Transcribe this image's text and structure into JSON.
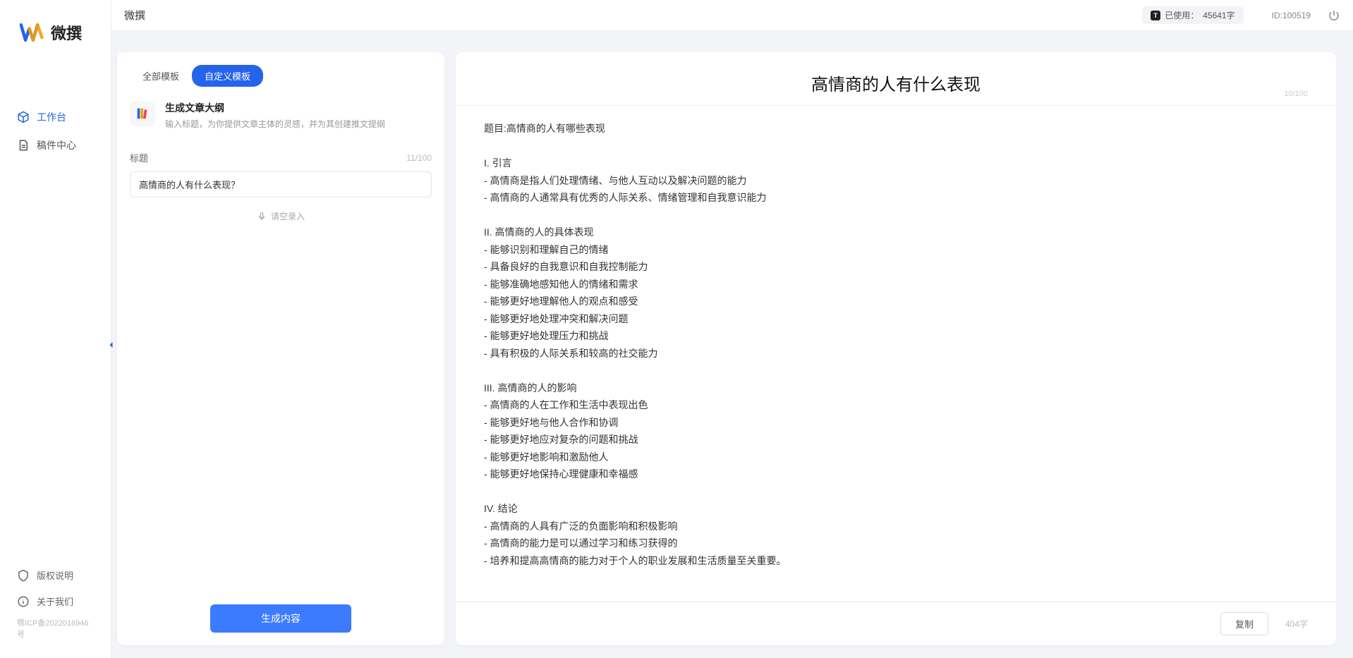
{
  "app": {
    "name": "微撰",
    "icp": "鄂ICP备2022016946号"
  },
  "sidebar": {
    "items": [
      {
        "label": "工作台",
        "icon": "cube"
      },
      {
        "label": "稿件中心",
        "icon": "document"
      }
    ],
    "footer": [
      {
        "label": "版权说明",
        "icon": "shield"
      },
      {
        "label": "关于我们",
        "icon": "info"
      }
    ]
  },
  "topbar": {
    "title": "微撰",
    "usage_prefix": "已使用：",
    "usage_value": "45641字",
    "user_id": "ID:100519"
  },
  "left_panel": {
    "tabs": [
      {
        "label": "全部模板",
        "active": false
      },
      {
        "label": "自定义模板",
        "active": true
      }
    ],
    "template": {
      "title": "生成文章大纲",
      "desc": "输入标题，为你提供文章主体的灵感，并为其创建推文提纲"
    },
    "form": {
      "label": "标题",
      "counter": "11/100",
      "input_value": "高情商的人有什么表现？",
      "voice_label": "请空录入"
    },
    "generate_label": "生成内容"
  },
  "right_panel": {
    "title": "高情商的人有什么表现",
    "title_counter": "10/100",
    "body": "题目:高情商的人有哪些表现\n\nI. 引言\n- 高情商是指人们处理情绪、与他人互动以及解决问题的能力\n- 高情商的人通常具有优秀的人际关系、情绪管理和自我意识能力\n\nII. 高情商的人的具体表现\n- 能够识别和理解自己的情绪\n- 具备良好的自我意识和自我控制能力\n- 能够准确地感知他人的情绪和需求\n- 能够更好地理解他人的观点和感受\n- 能够更好地处理冲突和解决问题\n- 能够更好地处理压力和挑战\n- 具有积极的人际关系和较高的社交能力\n\nIII. 高情商的人的影响\n- 高情商的人在工作和生活中表现出色\n- 能够更好地与他人合作和协调\n- 能够更好地应对复杂的问题和挑战\n- 能够更好地影响和激励他人\n- 能够更好地保持心理健康和幸福感\n\nIV. 结论\n- 高情商的人具有广泛的负面影响和积极影响\n- 高情商的能力是可以通过学习和练习获得的\n- 培养和提高高情商的能力对于个人的职业发展和生活质量至关重要。",
    "copy_label": "复制",
    "word_count": "404字"
  }
}
